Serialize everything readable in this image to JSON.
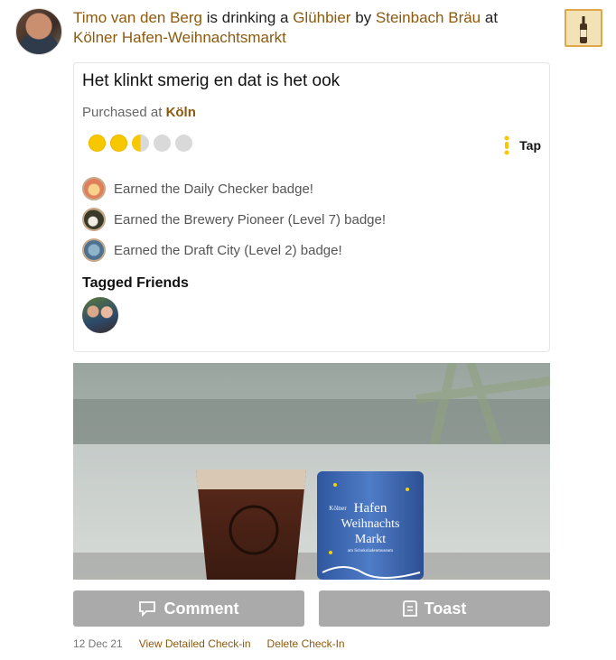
{
  "checkin": {
    "user_name": "Timo van den Berg",
    "text_drinking": "is drinking a",
    "beer_name": "Glühbier",
    "text_by": "by",
    "brewery_name": "Steinbach Bräu",
    "text_at": "at",
    "venue_name": "Kölner Hafen-Weihnachtsmarkt",
    "comment": "Het klinkt smerig en dat is het ook",
    "purchased_prefix": "Purchased at",
    "purchased_location": "Köln",
    "rating_caps": 2.5,
    "rating_max": 5,
    "serving_type": "Tap"
  },
  "badges": [
    {
      "text": "Earned the Daily Checker badge!",
      "icon": "daily-checker-badge-icon"
    },
    {
      "text": "Earned the Brewery Pioneer (Level 7) badge!",
      "icon": "brewery-pioneer-badge-icon"
    },
    {
      "text": "Earned the Draft City (Level 2) badge!",
      "icon": "draft-city-badge-icon"
    }
  ],
  "tagged": {
    "title": "Tagged Friends"
  },
  "photo": {
    "mug_text_1": "Kölner",
    "mug_text_2": "Hafen",
    "mug_text_3": "Weihnachts",
    "mug_text_4": "Markt",
    "mug_text_5": "am Schokoladenmuseum"
  },
  "actions": {
    "comment_label": "Comment",
    "toast_label": "Toast"
  },
  "footer": {
    "date": "12 Dec 21",
    "view_detailed": "View Detailed Check-in",
    "delete": "Delete Check-In"
  },
  "colors": {
    "link": "#8c5a0f",
    "cap_full": "#f7c800",
    "cap_empty": "#d9d9d9",
    "button_bg": "#aaaaaa"
  }
}
